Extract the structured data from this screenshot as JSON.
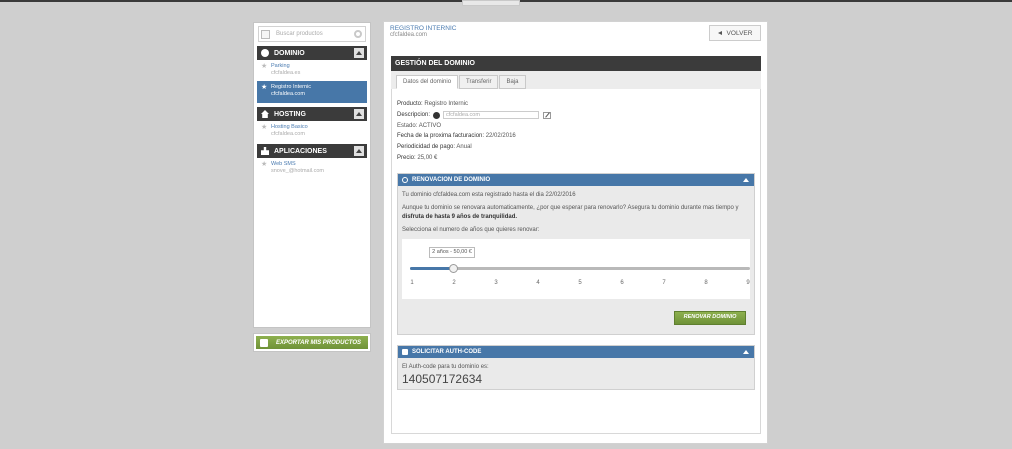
{
  "sidebar": {
    "search_placeholder": "Buscar productos",
    "sections": [
      {
        "title": "DOMINIO",
        "items": [
          {
            "title": "Parking",
            "sub": "cfcfaldea.es"
          },
          {
            "title": "Registro Internic",
            "sub": "cfcfaldea.com"
          }
        ]
      },
      {
        "title": "HOSTING",
        "items": [
          {
            "title": "Hosting Basico",
            "sub": "cfcfaldea.com"
          }
        ]
      },
      {
        "title": "APLICACIONES",
        "items": [
          {
            "title": "Web SMS",
            "sub": "snove_@hotmail.com"
          }
        ]
      }
    ],
    "export_label": "EXPORTAR MIS PRODUCTOS"
  },
  "header": {
    "title": "REGISTRO INTERNIC",
    "subtitle": "cfcfaldea.com",
    "back_label": "VOLVER"
  },
  "section_title": "GESTIÓN DEL DOMINIO",
  "tabs": [
    {
      "label": "Datos del dominio",
      "active": true
    },
    {
      "label": "Transferir",
      "active": false
    },
    {
      "label": "Baja",
      "active": false
    }
  ],
  "details": {
    "producto_label": "Producto:",
    "producto_value": "Registro Internic",
    "descripcion_label": "Descripcion:",
    "descripcion_placeholder": "cfcfaldea.com",
    "estado_label": "Estado:",
    "estado_value": "ACTIVO",
    "fecha_label": "Fecha de la proxima facturacion:",
    "fecha_value": "22/02/2016",
    "periodicidad_label": "Periodicidad de pago:",
    "periodicidad_value": "Anual",
    "precio_label": "Precio:",
    "precio_value": "25,00 €"
  },
  "renovacion": {
    "title": "RENOVACION DE DOMINIO",
    "line1": "Tu dominio cfcfaldea.com esta registrado hasta el dia 22/02/2016",
    "line2a": "Aunque tu dominio se renovara automaticamente, ¿por que esperar para renovarlo? Asegura tu dominio durante mas tiempo y ",
    "line2b": "disfruta de hasta 9 años de tranquilidad.",
    "line3": "Selecciona el numero de años que quieres renovar:",
    "tooltip": "2 años - 50,00 €",
    "selected_years": 2,
    "ticks": [
      "1",
      "2",
      "3",
      "4",
      "5",
      "6",
      "7",
      "8",
      "9"
    ],
    "button": "RENOVAR DOMINIO"
  },
  "authcode": {
    "title": "SOLICITAR AUTH-CODE",
    "text": "El Auth-code para tu dominio es:",
    "code": "140507172634"
  },
  "colors": {
    "dark_header": "#3b3b3b",
    "accent_blue": "#4777a8",
    "green_button": "#7ea044"
  }
}
